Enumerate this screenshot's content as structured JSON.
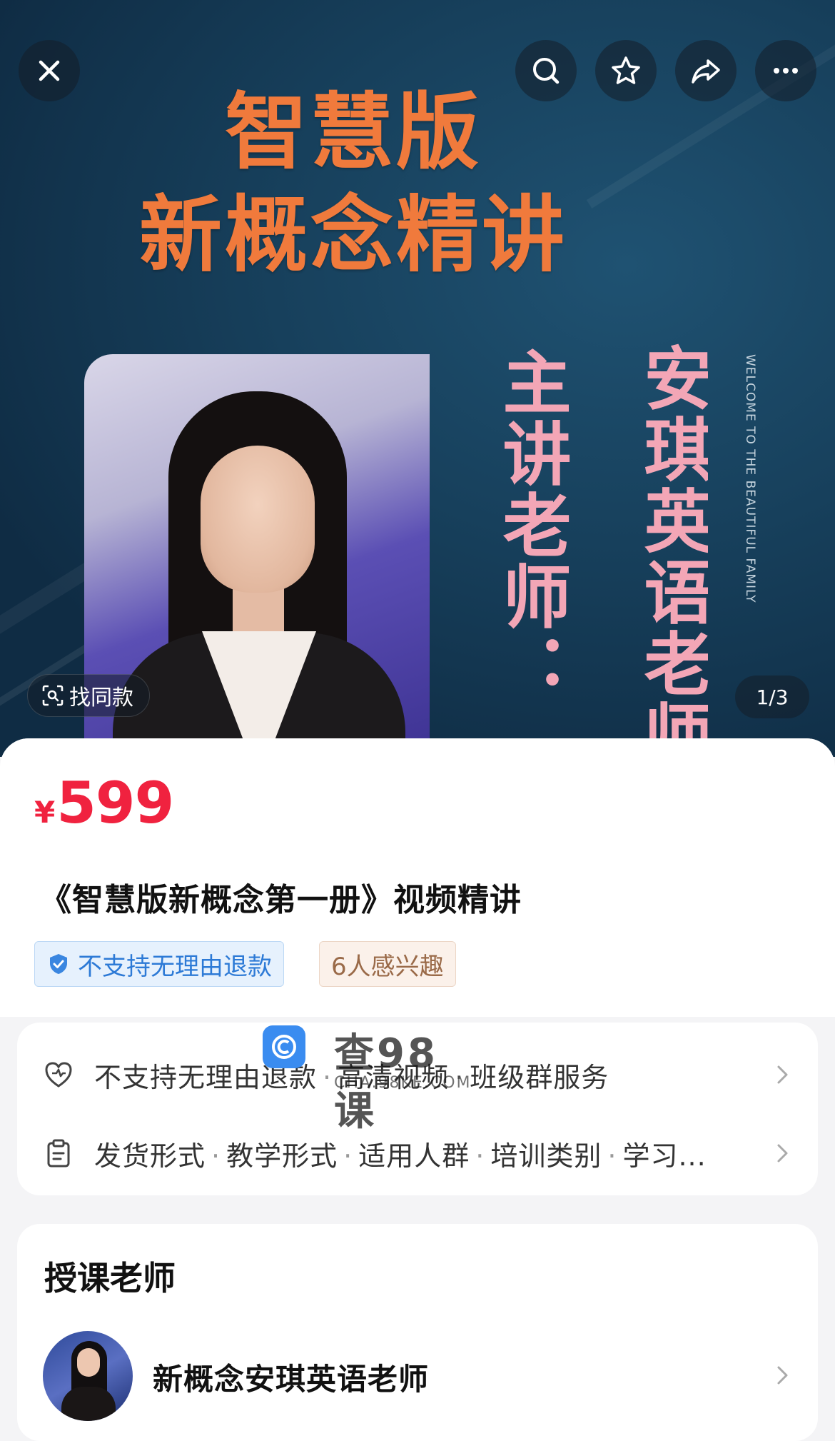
{
  "hero": {
    "title_line1": "智慧版",
    "title_line2": "新概念精讲",
    "vertical_left": "主讲老师：",
    "vertical_right": "安琪英语老师",
    "vertical_small": "WELCOME TO THE BEAUTIFUL FAMILY",
    "find_same_label": "找同款",
    "page_counter": "1/3",
    "title_color": "#f07a3c",
    "vertical_color": "#f3a6b6"
  },
  "toolbar": {
    "icons": [
      "close-icon",
      "search-icon",
      "star-icon",
      "share-icon",
      "more-icon"
    ]
  },
  "product": {
    "currency": "¥",
    "price": "599",
    "price_color": "#f0223f",
    "title": "《智慧版新概念第一册》视频精讲",
    "tags": {
      "refund": "不支持无理由退款",
      "interest": "6人感兴趣"
    }
  },
  "services": {
    "row1": {
      "items": [
        "不支持无理由退款",
        "高清视频",
        "班级群服务"
      ]
    },
    "row2": {
      "items": [
        "发货形式",
        "教学形式",
        "适用人群",
        "培训类别",
        "学习..."
      ]
    },
    "separator": "·"
  },
  "watermark": {
    "brand": "查98课",
    "url": "CHA.98KE.COM"
  },
  "teacher": {
    "heading": "授课老师",
    "name": "新概念安琪英语老师"
  }
}
